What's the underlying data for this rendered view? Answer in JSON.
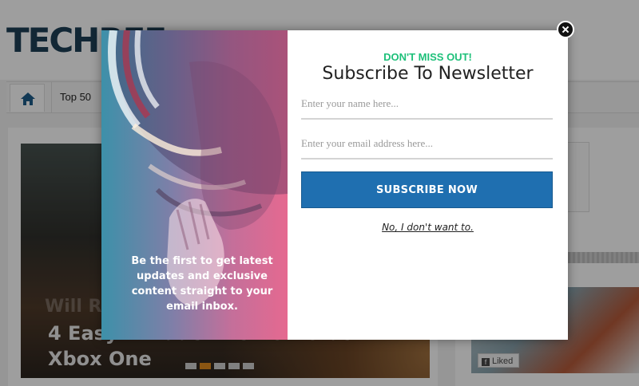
{
  "site": {
    "logo_text": "TECHREE",
    "nav": {
      "home_icon": "home-icon",
      "items": [
        {
          "label": "Top 50"
        }
      ]
    },
    "hero": {
      "faint_text": "Will R",
      "title": "4 Easy... Made The PS4 Crush Xbox One",
      "slide_count": 5,
      "active_slide": 2
    },
    "sidebar": {
      "like_label": "Liked"
    }
  },
  "modal": {
    "kicker": "DON'T MISS OUT!",
    "title": "Subscribe To Newsletter",
    "promo_text": "Be the first to get latest updates and exclusive content straight to your email inbox.",
    "name_placeholder": "Enter your name here...",
    "email_placeholder": "Enter your email address here...",
    "subscribe_label": "SUBSCRIBE NOW",
    "decline_label": "No, I don't want to.",
    "close_icon": "close-icon"
  },
  "colors": {
    "accent_green": "#1ec07a",
    "button_blue": "#1f6fb0",
    "gradient_left": "#3d90a9",
    "gradient_right": "#e56990"
  }
}
